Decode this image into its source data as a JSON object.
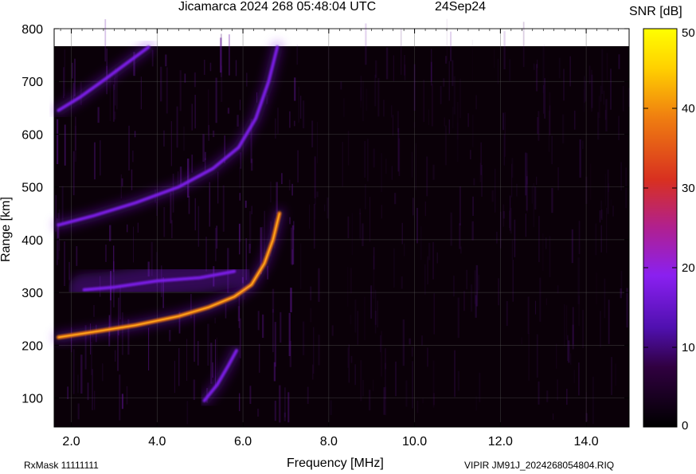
{
  "header": {
    "title": "Jicamarca 2024 268 05:48:04 UTC",
    "date": "24Sep24"
  },
  "footer": {
    "rxmask": "RxMask 11111111",
    "fileinfo": "VIPIR  JM91J_2024268054804.RIQ"
  },
  "colorbar": {
    "label": "SNR [dB]",
    "ticks": [
      0,
      10,
      20,
      30,
      40,
      50
    ],
    "range": [
      0,
      50
    ]
  },
  "colors": {
    "background": "#0a0008",
    "echo_low": "#7a1fe6",
    "echo_high": "#f07a10",
    "grid": "#555555"
  },
  "chart_data": {
    "type": "heatmap",
    "xlabel": "Frequency [MHz]",
    "ylabel": "Range [km]",
    "xlim": [
      1.6,
      15.0
    ],
    "ylim": [
      45,
      800
    ],
    "x_ticks": [
      2.0,
      4.0,
      6.0,
      8.0,
      10.0,
      12.0,
      14.0
    ],
    "y_ticks": [
      100,
      200,
      300,
      400,
      500,
      600,
      700,
      800
    ],
    "grid": true,
    "traces": [
      {
        "trace": "main-echo",
        "snr_db": 30,
        "points": [
          [
            1.7,
            215
          ],
          [
            2.5,
            225
          ],
          [
            3.5,
            238
          ],
          [
            4.5,
            255
          ],
          [
            5.2,
            272
          ],
          [
            5.8,
            292
          ],
          [
            6.2,
            315
          ],
          [
            6.5,
            355
          ],
          [
            6.7,
            400
          ],
          [
            6.85,
            450
          ]
        ]
      },
      {
        "trace": "multihop-echo",
        "snr_db": 18,
        "points": [
          [
            1.7,
            428
          ],
          [
            2.5,
            445
          ],
          [
            3.5,
            470
          ],
          [
            4.5,
            500
          ],
          [
            5.3,
            535
          ],
          [
            5.9,
            575
          ],
          [
            6.3,
            630
          ],
          [
            6.6,
            700
          ],
          [
            6.8,
            765
          ]
        ]
      },
      {
        "trace": "upper-echo",
        "snr_db": 16,
        "points": [
          [
            1.7,
            645
          ],
          [
            2.2,
            670
          ],
          [
            2.8,
            705
          ],
          [
            3.3,
            735
          ],
          [
            3.8,
            765
          ]
        ]
      },
      {
        "trace": "spread-echo",
        "snr_db": 13,
        "points": [
          [
            2.3,
            305
          ],
          [
            3.0,
            310
          ],
          [
            4.0,
            322
          ],
          [
            5.0,
            328
          ],
          [
            5.8,
            340
          ]
        ]
      },
      {
        "trace": "lower-echo",
        "snr_db": 12,
        "points": [
          [
            5.1,
            95
          ],
          [
            5.4,
            125
          ],
          [
            5.65,
            160
          ],
          [
            5.85,
            190
          ]
        ]
      }
    ]
  }
}
